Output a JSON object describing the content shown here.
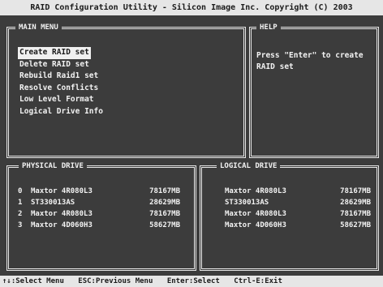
{
  "title": "RAID Configuration Utility - Silicon Image Inc. Copyright (C) 2003",
  "main_menu": {
    "title": "MAIN MENU",
    "items": [
      "Create RAID set",
      "Delete RAID set",
      "Rebuild Raid1 set",
      "Resolve Conflicts",
      "Low Level Format",
      "Logical Drive Info"
    ],
    "selected_index": 0
  },
  "help": {
    "title": "HELP",
    "text": "Press \"Enter\" to create RAID set"
  },
  "physical_drive": {
    "title": "PHYSICAL DRIVE",
    "rows": [
      {
        "index": "0",
        "model": "Maxtor 4R080L3",
        "size": "78167MB"
      },
      {
        "index": "1",
        "model": "ST330013AS",
        "size": "28629MB"
      },
      {
        "index": "2",
        "model": "Maxtor 4R080L3",
        "size": "78167MB"
      },
      {
        "index": "3",
        "model": "Maxtor 4D060H3",
        "size": "58627MB"
      }
    ]
  },
  "logical_drive": {
    "title": "LOGICAL DRIVE",
    "rows": [
      {
        "model": "Maxtor 4R080L3",
        "size": "78167MB"
      },
      {
        "model": "ST330013AS",
        "size": "28629MB"
      },
      {
        "model": "Maxtor 4R080L3",
        "size": "78167MB"
      },
      {
        "model": "Maxtor 4D060H3",
        "size": "58627MB"
      }
    ]
  },
  "status_bar": {
    "items": [
      "↑↓:Select Menu",
      "ESC:Previous Menu",
      "Enter:Select",
      "Ctrl-E:Exit"
    ]
  }
}
